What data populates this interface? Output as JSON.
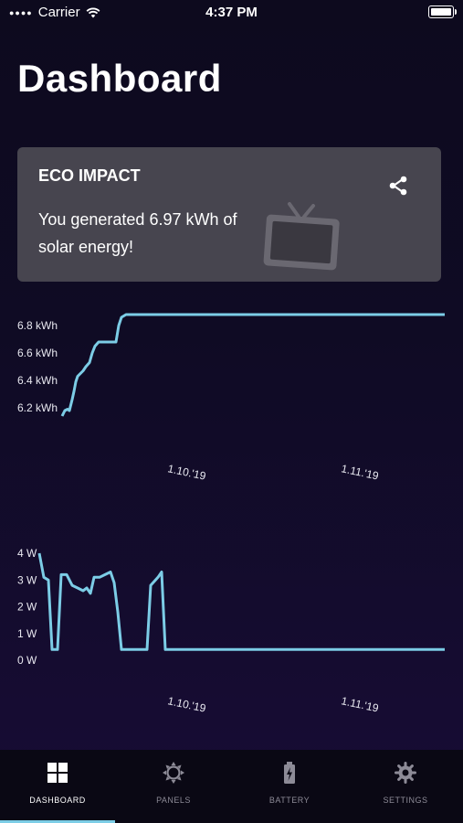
{
  "status_bar": {
    "carrier": "Carrier",
    "time": "4:37 PM"
  },
  "page_title": "Dashboard",
  "eco_card": {
    "heading": "ECO IMPACT",
    "text": "You generated 6.97 kWh of solar energy!",
    "icons": [
      "share-icon",
      "tv-icon"
    ]
  },
  "colors": {
    "line": "#7ccde6",
    "card": "#47454f",
    "active_tab": "#ffffff",
    "inactive_tab": "#8d8b97"
  },
  "chart_data": [
    {
      "type": "line",
      "series_color": "#7ccde6",
      "ylim": [
        6.1,
        6.9
      ],
      "ytick_labels": [
        "6.8 kWh",
        "6.6 kWh",
        "6.4 kWh",
        "6.2 kWh"
      ],
      "yticks": [
        6.8,
        6.6,
        6.4,
        6.2
      ],
      "xtick_labels": [
        "1.10.'19",
        "1.11.'19"
      ],
      "points": [
        [
          0,
          6.14
        ],
        [
          3,
          6.18
        ],
        [
          6,
          6.19
        ],
        [
          8,
          6.18
        ],
        [
          11,
          6.26
        ],
        [
          13,
          6.32
        ],
        [
          15,
          6.39
        ],
        [
          17,
          6.43
        ],
        [
          20,
          6.45
        ],
        [
          23,
          6.47
        ],
        [
          26,
          6.5
        ],
        [
          30,
          6.53
        ],
        [
          33,
          6.6
        ],
        [
          36,
          6.65
        ],
        [
          40,
          6.68
        ],
        [
          45,
          6.68
        ],
        [
          50,
          6.68
        ],
        [
          55,
          6.68
        ],
        [
          59,
          6.68
        ],
        [
          62,
          6.8
        ],
        [
          65,
          6.86
        ],
        [
          70,
          6.88
        ],
        [
          80,
          6.88
        ],
        [
          100,
          6.88
        ],
        [
          150,
          6.88
        ],
        [
          200,
          6.88
        ],
        [
          250,
          6.88
        ],
        [
          300,
          6.88
        ],
        [
          350,
          6.88
        ],
        [
          419,
          6.88
        ]
      ]
    },
    {
      "type": "line",
      "series_color": "#7ccde6",
      "ylim": [
        0,
        4
      ],
      "ytick_labels": [
        "4 W",
        "3 W",
        "2 W",
        "1 W",
        "0 W"
      ],
      "yticks": [
        4,
        3,
        2,
        1,
        0
      ],
      "xtick_labels": [
        "1.10.'19",
        "1.11.'19"
      ],
      "points": [
        [
          0,
          4.0
        ],
        [
          5,
          3.1
        ],
        [
          10,
          3.0
        ],
        [
          14,
          0.4
        ],
        [
          20,
          0.4
        ],
        [
          24,
          3.2
        ],
        [
          30,
          3.2
        ],
        [
          36,
          2.8
        ],
        [
          42,
          2.7
        ],
        [
          48,
          2.6
        ],
        [
          52,
          2.7
        ],
        [
          56,
          2.5
        ],
        [
          60,
          3.1
        ],
        [
          66,
          3.1
        ],
        [
          72,
          3.2
        ],
        [
          78,
          3.3
        ],
        [
          82,
          2.9
        ],
        [
          86,
          1.8
        ],
        [
          90,
          0.4
        ],
        [
          100,
          0.4
        ],
        [
          110,
          0.4
        ],
        [
          118,
          0.4
        ],
        [
          122,
          2.8
        ],
        [
          130,
          3.1
        ],
        [
          134,
          3.3
        ],
        [
          138,
          0.4
        ],
        [
          150,
          0.4
        ],
        [
          200,
          0.4
        ],
        [
          300,
          0.4
        ],
        [
          400,
          0.4
        ],
        [
          444,
          0.4
        ]
      ]
    }
  ],
  "tabs": [
    {
      "label": "DASHBOARD",
      "icon": "grid-icon",
      "active": true
    },
    {
      "label": "PANELS",
      "icon": "sun-icon",
      "active": false
    },
    {
      "label": "BATTERY",
      "icon": "battery-icon",
      "active": false
    },
    {
      "label": "SETTINGS",
      "icon": "gear-icon",
      "active": false
    }
  ]
}
